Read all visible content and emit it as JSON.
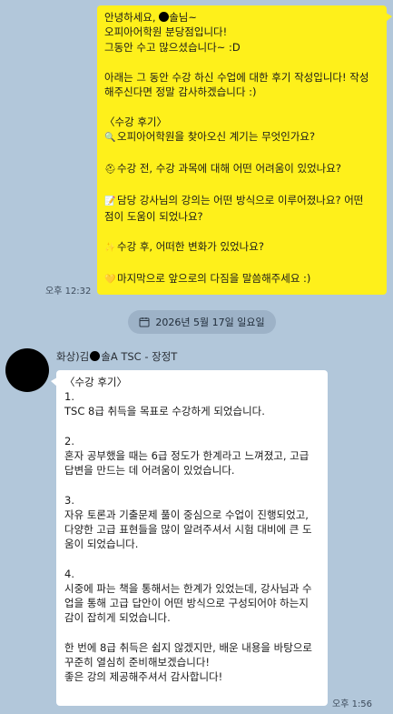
{
  "outgoing": {
    "greeting_pre": "안녕하세요, ",
    "greeting_post": "솔님~",
    "lines": [
      "오피아어학원 분당점입니다!",
      "그동안 수고 많으셨습니다~ :D",
      "",
      "아래는 그 동안 수강 하신 수업에 대한 후기 작성입니다! 작성",
      "해주신다면 정말 감사하겠습니다 :)",
      "",
      "〈수강 후기〉"
    ],
    "questions": [
      {
        "icon": "magnifier-icon",
        "glyph": "🔍",
        "text": "오피아어학원을 찾아오신 계기는 무엇인가요?"
      },
      {
        "icon": "construction-icon",
        "glyph": "⛑",
        "text": "수강 전, 수강 과목에 대해 어떤 어려움이 있었나요?"
      },
      {
        "icon": "memo-icon",
        "glyph": "📝",
        "text": "담당 강사님의 강의는 어떤 방식으로 이루어졌나요? 어떤",
        "cont": "점이 도움이 되었나요?"
      },
      {
        "icon": "sparkle-wand-icon",
        "glyph": "✨",
        "text": "수강 후, 어떠한 변화가 있었나요?"
      },
      {
        "icon": "heart-icon",
        "glyph": "💛",
        "text": "마지막으로 앞으로의 다짐을 말씀해주세요 :)"
      }
    ],
    "time": "오후 12:32"
  },
  "date_divider": "2026년 5월 17일 일요일",
  "incoming": {
    "sender_pre": "화상)김",
    "sender_post": "솔A TSC - 장정T",
    "lines": [
      "〈수강 후기〉",
      "1.",
      "TSC 8급 취득을 목표로 수강하게 되었습니다.",
      "",
      "2.",
      "혼자 공부했을 때는 6급 정도가 한계라고 느껴졌고, 고급",
      "답변을 만드는 데 어려움이 있었습니다.",
      "",
      "3.",
      "자유 토론과 기출문제 풀이 중심으로 수업이 진행되었고,",
      "다양한 고급 표현들을 많이 알려주셔서 시험 대비에 큰 도",
      "움이 되었습니다.",
      "",
      "4.",
      "시중에 파는 책을 통해서는 한계가 있었는데, 강사님과 수",
      "업을 통해 고급 답안이 어떤 방식으로 구성되어야 하는지",
      "감이 잡히게 되었습니다.",
      "",
      "한 번에 8급 취득은 쉽지 않겠지만, 배운 내용을 바탕으로",
      "꾸준히 열심히 준비해보겠습니다!",
      "좋은 강의 제공해주셔서 감사합니다!"
    ],
    "time": "오후 1:56"
  },
  "colors": {
    "background": "#b2c7da",
    "outgoing_bubble": "#fef01b",
    "incoming_bubble": "#ffffff"
  }
}
